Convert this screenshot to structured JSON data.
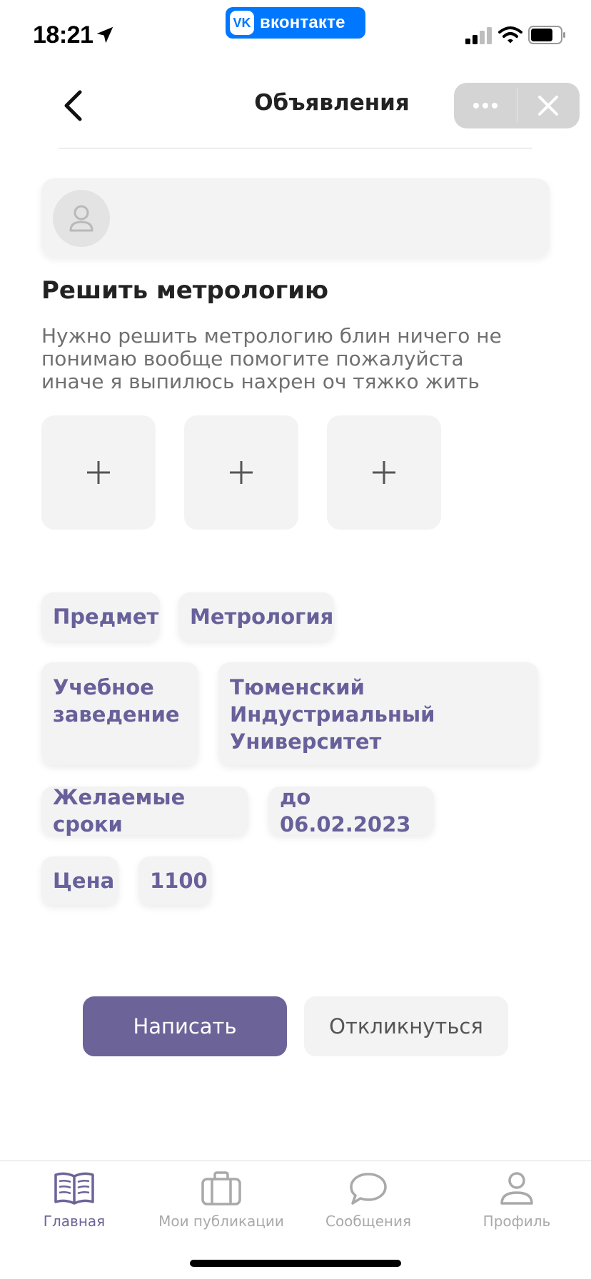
{
  "status_bar": {
    "time": "18:21",
    "vk_logo_text": "VK",
    "vk_label": "вконтакте",
    "icons": [
      "location-arrow-icon",
      "cellular-signal-icon",
      "wifi-icon",
      "battery-icon"
    ]
  },
  "header": {
    "title": "Объявления",
    "icons": [
      "chevron-left-icon",
      "more-dots-icon",
      "close-icon"
    ]
  },
  "post": {
    "title": "Решить метрологию",
    "description": "Нужно решить метрологию блин ничего не понимаю вообще помогите пожалуйста иначе я выпилюсь нахрен оч тяжко жить",
    "photo_slots": 3
  },
  "details": {
    "subject_label": "Предмет",
    "subject_value": "Метрология",
    "institution_label": "Учебное заведение",
    "institution_value": "Тюменский Индустриальный Университет",
    "deadline_label": "Желаемые сроки",
    "deadline_value": "до 06.02.2023",
    "price_label": "Цена",
    "price_value": "1100"
  },
  "actions": {
    "write_label": "Написать",
    "respond_label": "Откликнуться"
  },
  "tabbar": {
    "items": [
      {
        "label": "Главная",
        "icon": "book-icon",
        "active": true
      },
      {
        "label": "Мои публикации",
        "icon": "briefcase-icon",
        "active": false
      },
      {
        "label": "Сообщения",
        "icon": "chat-bubble-icon",
        "active": false
      },
      {
        "label": "Профиль",
        "icon": "user-icon",
        "active": false
      }
    ]
  },
  "colors": {
    "accent": "#6c6499",
    "tag_text": "#68609a",
    "card_bg": "#f3f3f3",
    "vk_blue": "#0077ff"
  }
}
